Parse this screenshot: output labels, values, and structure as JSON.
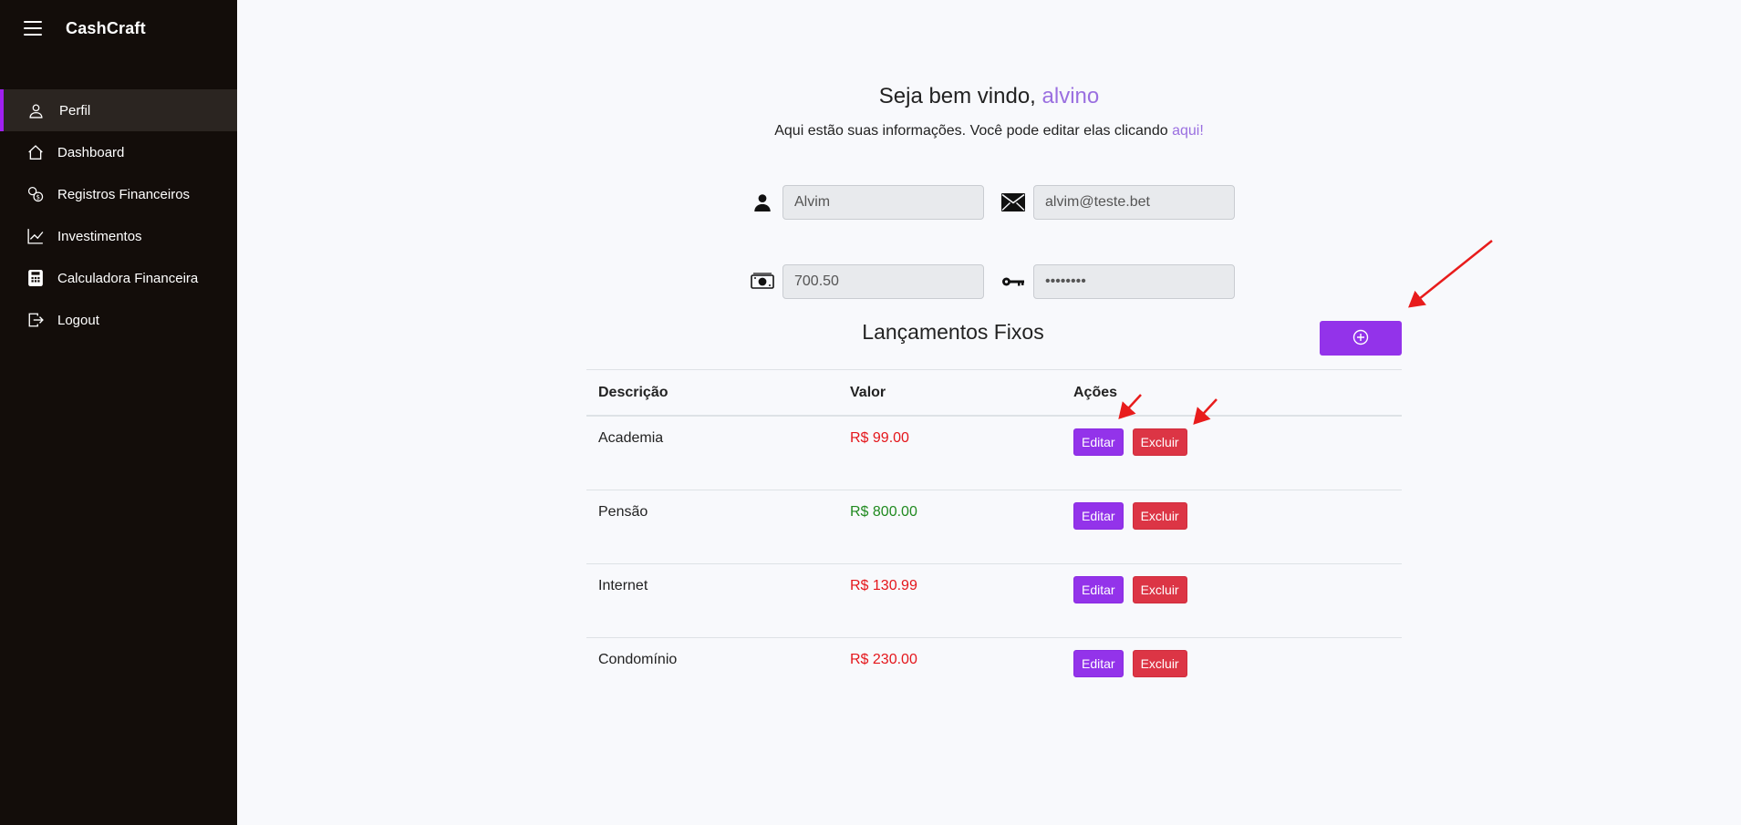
{
  "sidebar": {
    "brand": "CashCraft",
    "items": [
      {
        "label": "Perfil",
        "icon": "user-icon",
        "active": true
      },
      {
        "label": "Dashboard",
        "icon": "home-icon"
      },
      {
        "label": "Registros Financeiros",
        "icon": "coins-icon"
      },
      {
        "label": "Investimentos",
        "icon": "chart-line-icon"
      },
      {
        "label": "Calculadora Financeira",
        "icon": "calculator-icon"
      },
      {
        "label": "Logout",
        "icon": "logout-icon"
      }
    ]
  },
  "header": {
    "greeting": "Seja bem vindo, ",
    "username": "alvino",
    "subtitle": "Aqui estão suas informações. Você pode editar elas clicando ",
    "edit_link": "aqui!"
  },
  "profile": {
    "name": "Alvim",
    "email": "alvim@teste.bet",
    "balance": "700.50",
    "password": "••••••••"
  },
  "fixed": {
    "title": "Lançamentos Fixos",
    "add_icon": "plus-circle-icon",
    "columns": [
      "Descrição",
      "Valor",
      "Ações"
    ],
    "rows": [
      {
        "desc": "Academia",
        "value": "R$ 99.00",
        "type": "expense"
      },
      {
        "desc": "Pensão",
        "value": "R$ 800.00",
        "type": "income"
      },
      {
        "desc": "Internet",
        "value": "R$ 130.99",
        "type": "expense"
      },
      {
        "desc": "Condomínio",
        "value": "R$ 230.00",
        "type": "expense"
      }
    ],
    "edit_label": "Editar",
    "delete_label": "Excluir"
  },
  "colors": {
    "sidebar_bg": "#130d0a",
    "accent": "#9333ea",
    "danger": "#dc3545",
    "expense": "#e4161b",
    "income": "#208a20",
    "annotation": "#e81c1c"
  }
}
